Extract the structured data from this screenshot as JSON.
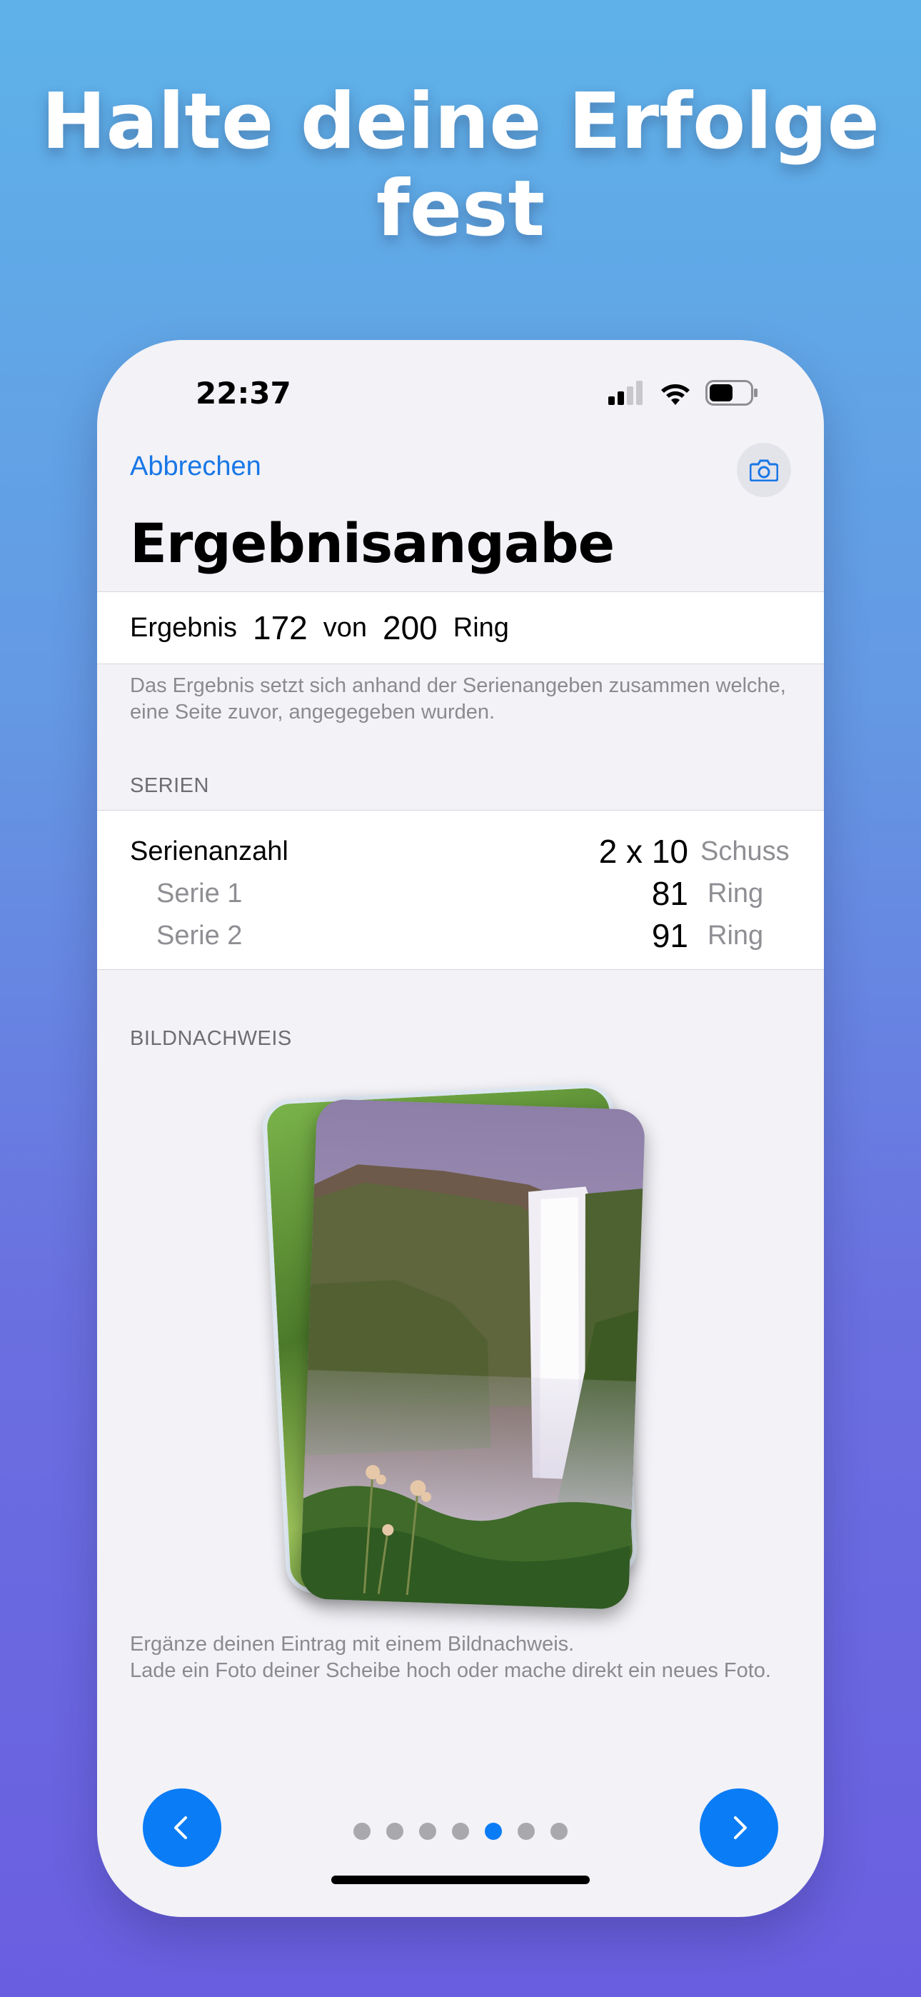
{
  "headline": {
    "line1": "Halte deine Erfolge",
    "line2": "fest"
  },
  "status_bar": {
    "time": "22:37",
    "icons": [
      "cellular-icon",
      "wifi-icon",
      "battery-icon"
    ]
  },
  "nav": {
    "cancel_label": "Abbrechen",
    "camera_icon": "camera-icon"
  },
  "page": {
    "title": "Ergebnisangabe"
  },
  "result": {
    "label": "Ergebnis",
    "value": "172",
    "of_label": "von",
    "max": "200",
    "unit": "Ring",
    "hint": "Das Ergebnis setzt sich anhand der Serienangeben zusammen welche, eine Seite zuvor, angegegeben wurden."
  },
  "series_section": {
    "header": "SERIEN",
    "count_label": "Serienanzahl",
    "count_value": "2 x 10",
    "count_unit": "Schuss",
    "rows": [
      {
        "label": "Serie 1",
        "value": "81",
        "unit": "Ring"
      },
      {
        "label": "Serie 2",
        "value": "91",
        "unit": "Ring"
      }
    ]
  },
  "image_section": {
    "header": "BILDNACHWEIS",
    "footer_line1": "Ergänze deinen Eintrag mit einem Bildnachweis.",
    "footer_line2": "Lade ein Foto deiner Scheibe hoch oder mache direkt ein neues Foto."
  },
  "pager": {
    "total": 7,
    "active": 5
  },
  "colors": {
    "accent": "#0a7cf5",
    "link": "#1877e6",
    "background": "#f2f2f7"
  }
}
